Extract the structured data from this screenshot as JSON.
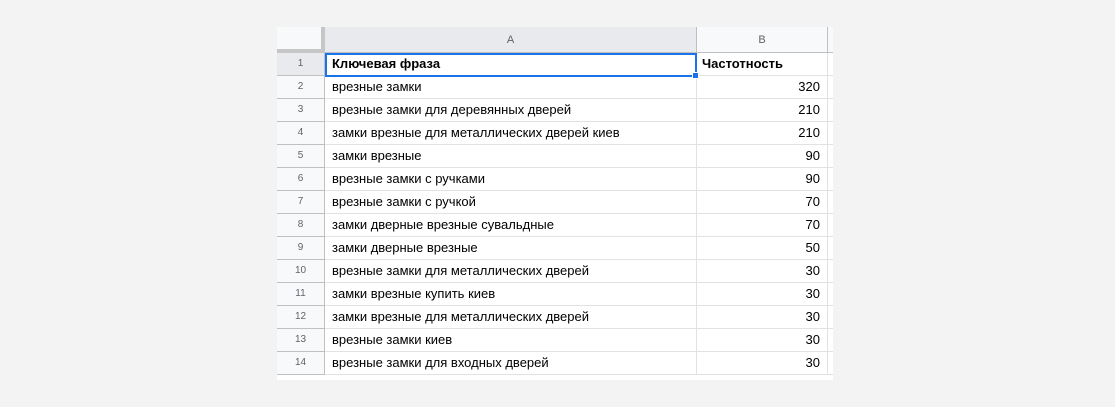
{
  "columns": [
    "A",
    "B"
  ],
  "header": {
    "row_number": "1",
    "phrase": "Ключевая фраза",
    "frequency": "Частотность"
  },
  "rows": [
    {
      "num": "2",
      "phrase": "врезные замки",
      "freq": "320"
    },
    {
      "num": "3",
      "phrase": "врезные замки для деревянных дверей",
      "freq": "210"
    },
    {
      "num": "4",
      "phrase": "замки врезные для металлических дверей киев",
      "freq": "210"
    },
    {
      "num": "5",
      "phrase": "замки врезные",
      "freq": "90"
    },
    {
      "num": "6",
      "phrase": "врезные замки с ручками",
      "freq": "90"
    },
    {
      "num": "7",
      "phrase": "врезные замки с ручкой",
      "freq": "70"
    },
    {
      "num": "8",
      "phrase": "замки дверные врезные сувальдные",
      "freq": "70"
    },
    {
      "num": "9",
      "phrase": "замки дверные врезные",
      "freq": "50"
    },
    {
      "num": "10",
      "phrase": "врезные замки для металлических дверей",
      "freq": "30"
    },
    {
      "num": "11",
      "phrase": "замки врезные купить киев",
      "freq": "30"
    },
    {
      "num": "12",
      "phrase": "замки врезные для металлических дверей",
      "freq": "30"
    },
    {
      "num": "13",
      "phrase": "врезные замки киев",
      "freq": "30"
    },
    {
      "num": "14",
      "phrase": "врезные замки для входных дверей",
      "freq": "30"
    }
  ],
  "colors": {
    "selection": "#1a73e8",
    "header_bg": "#f8f9fa",
    "selected_header_bg": "#e8eaed",
    "page_bg": "#f3f3f3"
  }
}
